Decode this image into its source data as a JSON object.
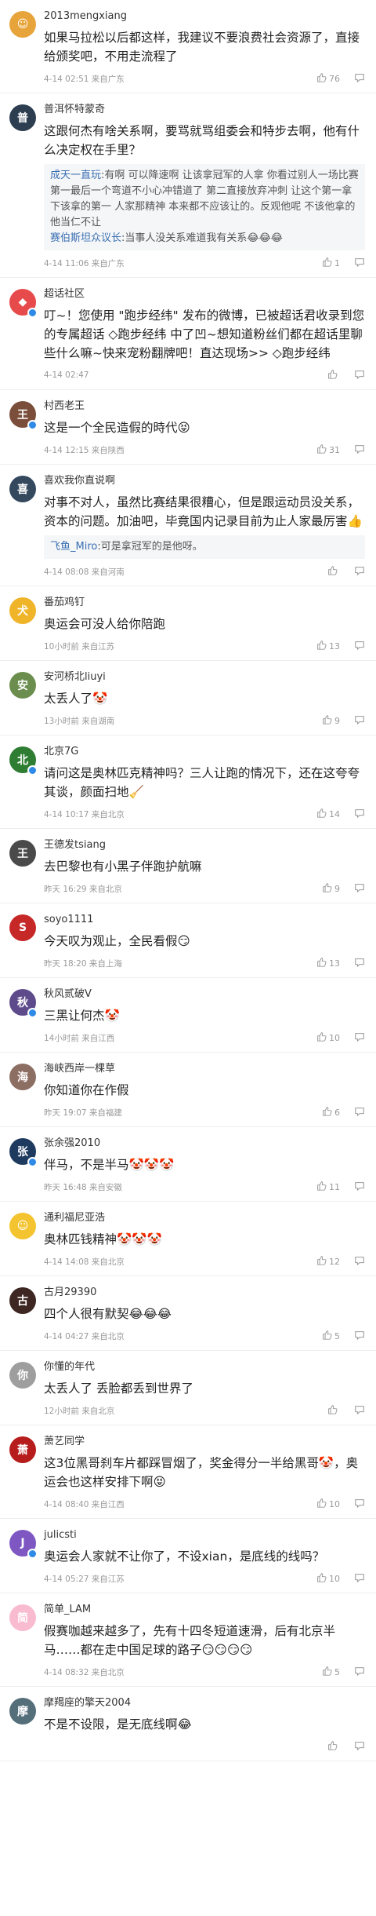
{
  "comments": [
    {
      "user": "2013mengxiang",
      "text": "如果马拉松以后都这样，我建议不要浪费社会资源了，直接给颁奖吧，不用走流程了",
      "time": "4-14 02:51 来自广东",
      "likes": "76",
      "avatar_color": "#e7a43b",
      "avatar_char": "☺",
      "verified": false
    },
    {
      "user": "普洱怀特蒙奇",
      "text": "这跟何杰有啥关系啊，要骂就骂组委会和特步去啊，他有什么决定权在手里？",
      "time": "4-14 11:06 来自广东",
      "likes": "1",
      "avatar_color": "#2c3e50",
      "avatar_char": "普",
      "verified": false,
      "quote": {
        "name": "成天一直玩",
        "text": ":有啊 可以降速啊 让该拿冠军的人拿 你看过别人一场比赛第一最后一个弯道不小心冲错道了 第二直接放弃冲刺 让这个第一拿下该拿的第一 人家那精神 本来都不应该让的。反观他呢 不该他拿的 他当仁不让",
        "name2": "赛伯斯坦众议长",
        "text2": ":当事人没关系难道我有关系😂😂😂"
      }
    },
    {
      "user": "超话社区",
      "text": "叮~！您使用 \"跑步经纬\" 发布的微博，已被超话君收录到您的专属超话 ◇跑步经纬 中了凹~想知道粉丝们都在超话里聊些什么嘛~快来宠粉翻牌吧！直达现场>> ◇跑步经纬",
      "time": "4-14 02:47",
      "likes": "",
      "avatar_color": "#e64a4a",
      "avatar_char": "◆",
      "verified": true
    },
    {
      "user": "村西老王",
      "text": "这是一个全民造假的時代😝",
      "time": "4-14 12:15 来自陕西",
      "likes": "31",
      "avatar_color": "#7a4e3a",
      "avatar_char": "王",
      "verified": true
    },
    {
      "user": "喜欢我你直说啊",
      "text": "对事不对人，虽然比赛结果很糟心，但是跟运动员没关系，资本的问题。加油吧，毕竟国内记录目前为止人家最厉害👍",
      "time": "4-14 08:08 来自河南",
      "likes": "",
      "avatar_color": "#34495e",
      "avatar_char": "喜",
      "verified": false,
      "quote": {
        "name": "飞鱼_Miro",
        "text": ":可是拿冠军的是他呀。"
      }
    },
    {
      "user": "番茄鸡钉",
      "text": "奥运会可没人给你陪跑",
      "time": "10小时前 来自江苏",
      "likes": "13",
      "avatar_color": "#f0b429",
      "avatar_char": "犬",
      "verified": false
    },
    {
      "user": "安河桥北liuyi",
      "text": "太丢人了🤡",
      "time": "13小时前 来自湖南",
      "likes": "9",
      "avatar_color": "#6b8e4e",
      "avatar_char": "安",
      "verified": false
    },
    {
      "user": "北京7G",
      "text": "请问这是奥林匹克精神吗？三人让跑的情况下，还在这夸夸其谈，颜面扫地🧹",
      "time": "4-14 10:17 来自北京",
      "likes": "14",
      "avatar_color": "#2e7d32",
      "avatar_char": "北",
      "verified": true
    },
    {
      "user": "王德发tsiang",
      "text": "去巴黎也有小黑子伴跑护航嘛",
      "time": "昨天 16:29 来自北京",
      "likes": "9",
      "avatar_color": "#4a4a4a",
      "avatar_char": "王",
      "verified": false
    },
    {
      "user": "soyo1111",
      "text": "今天叹为观止，全民看假😏",
      "time": "昨天 18:20 来自上海",
      "likes": "13",
      "avatar_color": "#c62828",
      "avatar_char": "S",
      "verified": false
    },
    {
      "user": "秋风贰破V",
      "text": "三黑让何杰🤡",
      "time": "14小时前 来自江西",
      "likes": "10",
      "avatar_color": "#5e4b8b",
      "avatar_char": "秋",
      "verified": true
    },
    {
      "user": "海峡西岸一棵草",
      "text": "你知道你在作假",
      "time": "昨天 19:07 来自福建",
      "likes": "6",
      "avatar_color": "#8d6e63",
      "avatar_char": "海",
      "verified": false
    },
    {
      "user": "张余强2010",
      "text": "伴马，不是半马🤡🤡🤡",
      "time": "昨天 16:48 来自安徽",
      "likes": "11",
      "avatar_color": "#1e3a5f",
      "avatar_char": "张",
      "verified": true
    },
    {
      "user": "通利福尼亚浩",
      "text": "奥林匹钱精神🤡🤡🤡",
      "time": "4-14 14:08 来自北京",
      "likes": "12",
      "avatar_color": "#f4c430",
      "avatar_char": "☺",
      "verified": false
    },
    {
      "user": "古月29390",
      "text": "四个人很有默契😂😂😂",
      "time": "4-14 04:27 来自北京",
      "likes": "5",
      "avatar_color": "#3e2723",
      "avatar_char": "古",
      "verified": false
    },
    {
      "user": "你懂的年代",
      "text": "太丢人了 丢脸都丢到世界了",
      "time": "12小时前 来自北京",
      "likes": "",
      "avatar_color": "#9e9e9e",
      "avatar_char": "你",
      "verified": false
    },
    {
      "user": "萧艺同学",
      "text": "这3位黑哥刹车片都踩冒烟了，奖金得分一半给黑哥🤡，奥运会也这样安排下啊😝",
      "time": "4-14 08:40 来自江西",
      "likes": "10",
      "avatar_color": "#b71c1c",
      "avatar_char": "萧",
      "verified": false
    },
    {
      "user": "julicsti",
      "text": "奥运会人家就不让你了，不设xian，是底线的线吗？",
      "time": "4-14 05:27 来自江苏",
      "likes": "10",
      "avatar_color": "#7e57c2",
      "avatar_char": "J",
      "verified": true
    },
    {
      "user": "简单_LAM",
      "text": "假赛咖越来越多了，先有十四冬短道速滑，后有北京半马……都在走中国足球的路子😏😏😏😏",
      "time": "4-14 08:32 来自北京",
      "likes": "5",
      "avatar_color": "#f8bbd0",
      "avatar_char": "简",
      "verified": false
    },
    {
      "user": "摩羯座的擎天2004",
      "text": "不是不设限，是无底线啊😂",
      "time": "",
      "likes": "",
      "avatar_color": "#546e7a",
      "avatar_char": "摩",
      "verified": false
    }
  ]
}
